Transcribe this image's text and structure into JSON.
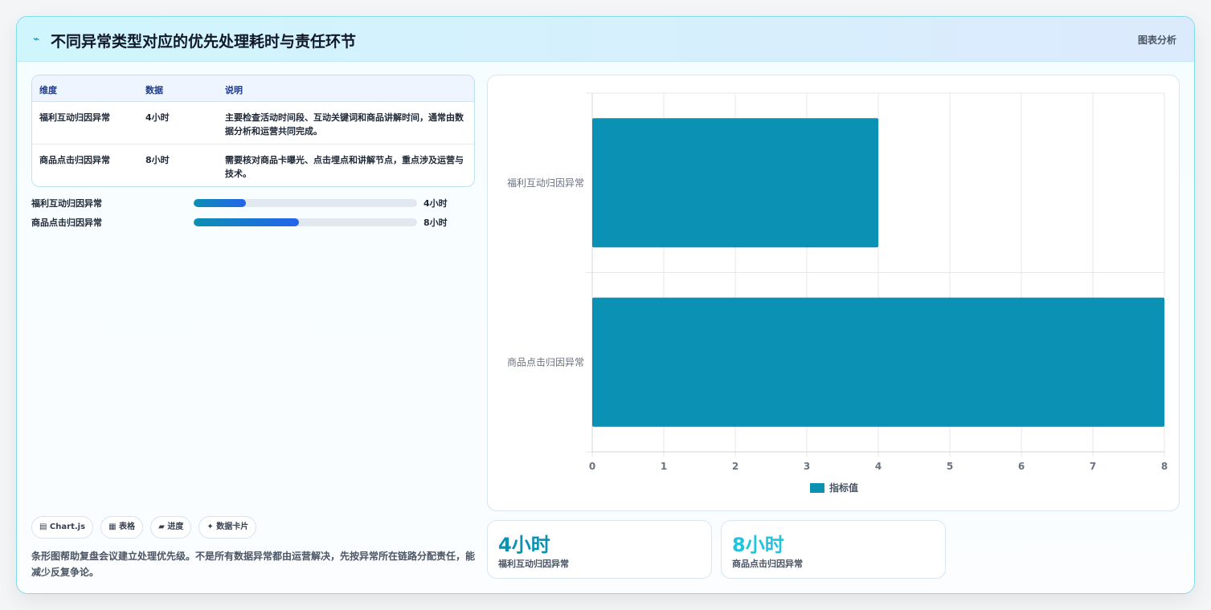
{
  "header": {
    "icon": "⌁",
    "title": "不同异常类型对应的优先处理耗时与责任环节",
    "tag": "图表分析"
  },
  "table": {
    "headers": [
      "维度",
      "数据",
      "说明"
    ],
    "rows": [
      {
        "dim": "福利互动归因异常",
        "value": "4小时",
        "desc": "主要检查活动时间段、互动关键词和商品讲解时间，通常由数据分析和运营共同完成。"
      },
      {
        "dim": "商品点击归因异常",
        "value": "8小时",
        "desc": "需要核对商品卡曝光、点击埋点和讲解节点，重点涉及运营与技术。"
      }
    ]
  },
  "progress": [
    {
      "label": "福利互动归因异常",
      "value_text": "4小时",
      "fraction": 0.235
    },
    {
      "label": "商品点击归因异常",
      "value_text": "8小时",
      "fraction": 0.47
    }
  ],
  "chips": [
    {
      "icon": "bar-chart-icon",
      "label": "▤ Chart.js"
    },
    {
      "icon": "table-icon",
      "label": "▦ 表格"
    },
    {
      "icon": "progress-icon",
      "label": "▰ 进度"
    },
    {
      "icon": "sparkle-icon",
      "label": "✦ 数据卡片"
    }
  ],
  "note": "条形图帮助复盘会议建立处理优先级。不是所有数据异常都由运营解决，先按异常所在链路分配责任，能减少反复争论。",
  "kpis": [
    {
      "value": "4小时",
      "label": "福利互动归因异常",
      "color": "#0891b2"
    },
    {
      "value": "8小时",
      "label": "商品点击归因异常",
      "color": "#22c3dc"
    }
  ],
  "chart_data": {
    "type": "bar",
    "orientation": "horizontal",
    "categories": [
      "福利互动归因异常",
      "商品点击归因异常"
    ],
    "series": [
      {
        "name": "指标值",
        "values": [
          4,
          8
        ],
        "color": "#0a91b4"
      }
    ],
    "xlim": [
      0,
      8
    ],
    "xticks": [
      "0",
      "1",
      "2",
      "3",
      "4",
      "5",
      "6",
      "7",
      "8"
    ],
    "grid": true,
    "legend": "bottom"
  }
}
